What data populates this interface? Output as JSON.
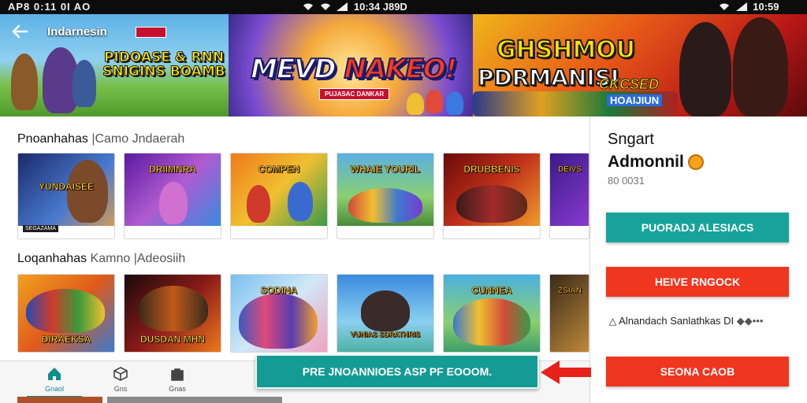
{
  "status_bar": {
    "left": "AP8 0:11 0I AO",
    "center": "10:34 J89D",
    "right": "10:59"
  },
  "app_bar": {
    "title": "Indarnesin",
    "promo_tag": ""
  },
  "banner": {
    "panel_a_text": "PIDOASE & RNN SNIGINS BOAMB",
    "panel_b_text_1": "MEVD ",
    "panel_b_text_2": "NAKEO!",
    "panel_b_sub": "PUJASAC DANKAR",
    "panel_c_text_1": "GHSHMOU",
    "panel_c_text_2": "PDRMANISI",
    "panel_c_text_3": "CKCSED",
    "panel_c_text_4": "HOAIJIUN"
  },
  "sections": [
    {
      "title": "Pnoanhahas",
      "subtitle": "|Camo Jndaerah",
      "cards": [
        {
          "label": "YUNDAISEE",
          "chip": "SEGAZAMA"
        },
        {
          "label": "DRIIMNRA",
          "chip": ""
        },
        {
          "label": "COMPEN",
          "chip": ""
        },
        {
          "label": "WHAIE YOURIL",
          "chip": ""
        },
        {
          "label": "DRUBBENIS",
          "chip": ""
        },
        {
          "label": "DEIVS",
          "chip": ""
        }
      ]
    },
    {
      "title": "Loqanhahas",
      "subtitle": "Kamno |Adeosiih",
      "cards": [
        {
          "label": "DIRAEKSA",
          "chip": ""
        },
        {
          "label": "DUSDAN MHN",
          "chip": ""
        },
        {
          "label": "SODINA",
          "chip": ""
        },
        {
          "label": "VUNIAS SDRATHRIS",
          "chip": ""
        },
        {
          "label": "CUNNEA",
          "chip": ""
        },
        {
          "label": "ZSIAN",
          "chip": ""
        }
      ]
    }
  ],
  "side_panel": {
    "title": "Sngart",
    "subtitle": "Admonnil",
    "meta": "80 0031",
    "button_primary": "PUORADJ ALESIACS",
    "button_secondary": "HEIVE RNGOCK",
    "note": "Alnandach Sanlathkas DI",
    "button_tertiary": "SEONA CAOB"
  },
  "bottom_nav": [
    {
      "label": "Gnaol",
      "icon": "home-icon"
    },
    {
      "label": "Gns",
      "icon": "cube-icon"
    },
    {
      "label": "Gnas",
      "icon": "bag-icon"
    }
  ],
  "cta": {
    "label": "PRE JNOANNIOES ASP PF EOOOM."
  },
  "colors": {
    "teal": "#17a39a",
    "red": "#f0361e",
    "nav_active": "#0f8d8a"
  }
}
